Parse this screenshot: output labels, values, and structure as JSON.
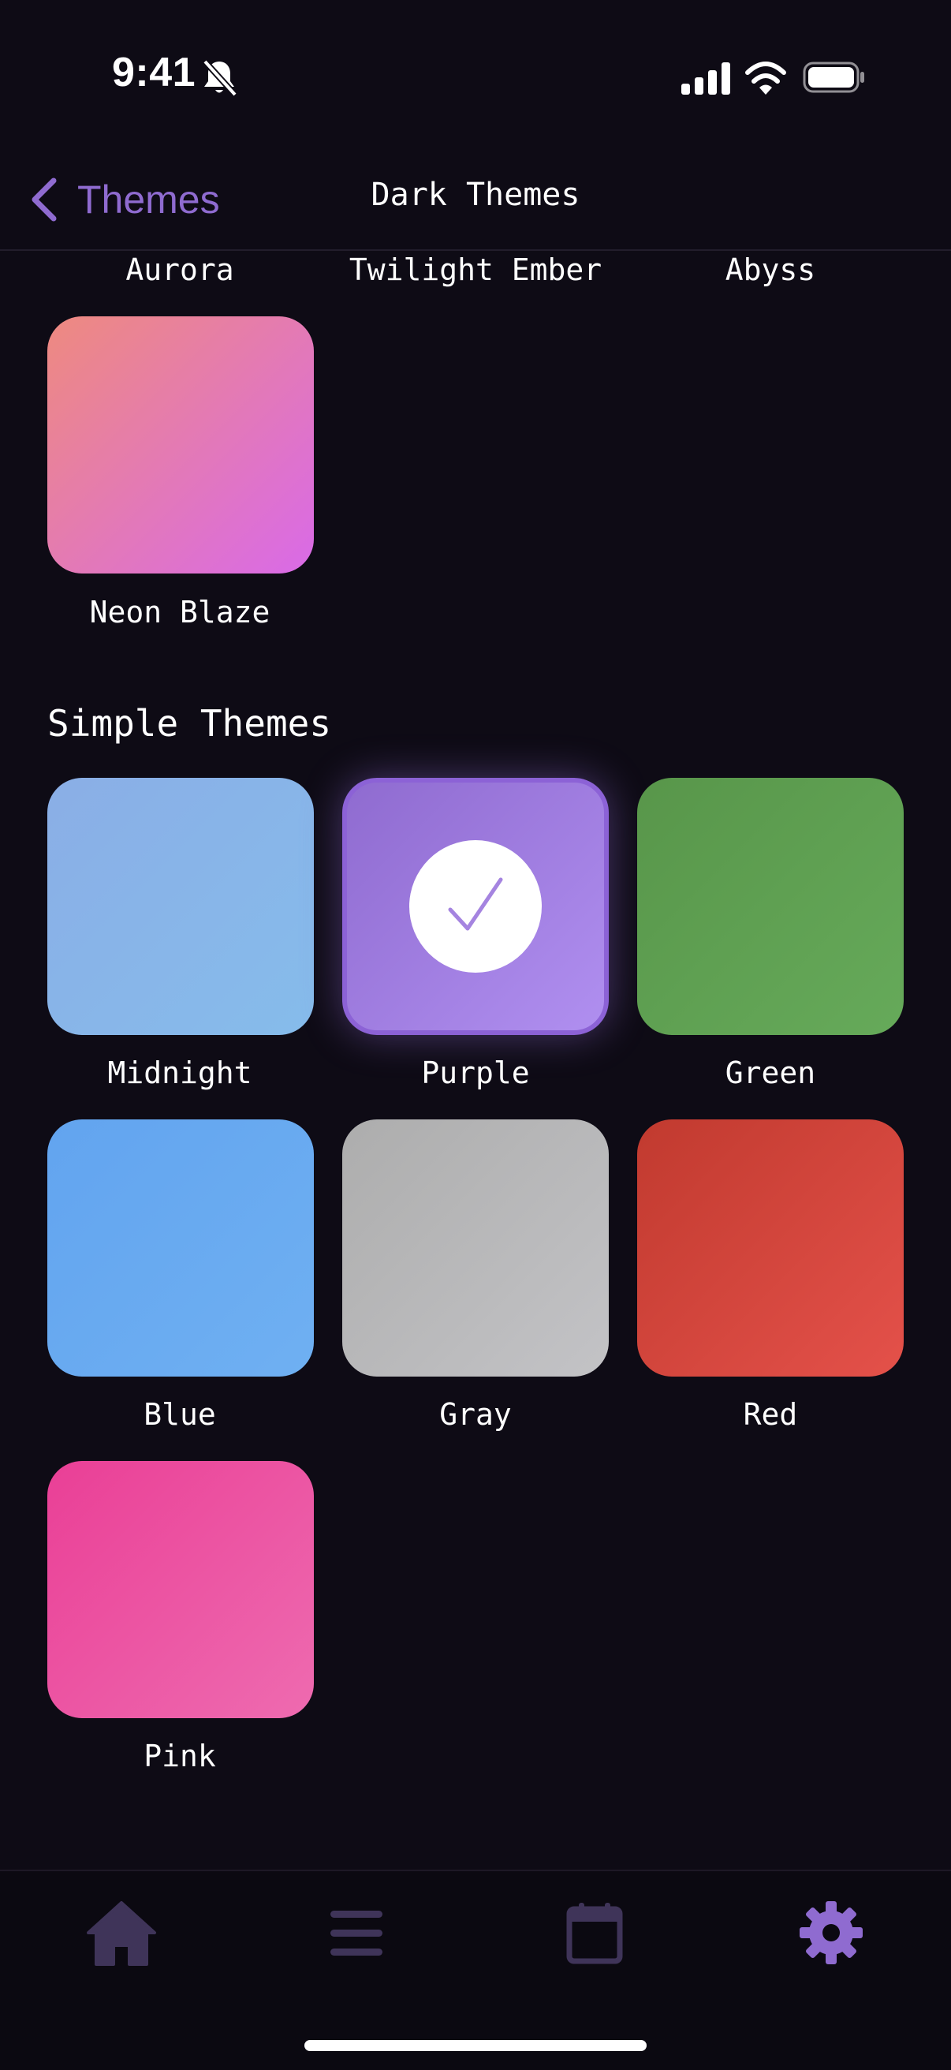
{
  "status_bar": {
    "time": "9:41"
  },
  "nav": {
    "back_label": "Themes",
    "title": "Dark Themes"
  },
  "dark_themes": {
    "partial_row_labels": [
      "Aurora",
      "Twilight Ember",
      "Abyss"
    ],
    "items": [
      {
        "label": "Neon Blaze",
        "colors": [
          "#ee8a7f",
          "#d96ae8"
        ]
      }
    ]
  },
  "simple_themes": {
    "title": "Simple Themes",
    "selected": "Purple",
    "items": [
      {
        "label": "Midnight",
        "colors": [
          "#8aaee6",
          "#86bceb"
        ]
      },
      {
        "label": "Purple",
        "colors": [
          "#8f6bd0",
          "#b08ff0"
        ]
      },
      {
        "label": "Green",
        "colors": [
          "#58964a",
          "#66aa5a"
        ]
      },
      {
        "label": "Blue",
        "colors": [
          "#62a4ef",
          "#6fb0f2"
        ]
      },
      {
        "label": "Gray",
        "colors": [
          "#adadad",
          "#c3c3c6"
        ]
      },
      {
        "label": "Red",
        "colors": [
          "#c13a2f",
          "#e4514a"
        ]
      },
      {
        "label": "Pink",
        "colors": [
          "#ea3f96",
          "#ee6bb0"
        ]
      }
    ]
  },
  "tab_bar": {
    "items": [
      "home-icon",
      "menu-icon",
      "calendar-icon",
      "settings-icon"
    ],
    "active": "settings-icon",
    "inactive_color": "#3f3459",
    "active_color": "#8f6bd0"
  }
}
